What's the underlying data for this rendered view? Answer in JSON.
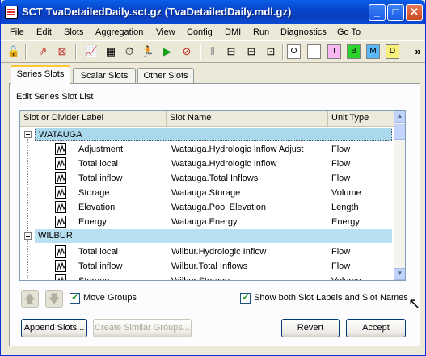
{
  "window": {
    "title": "SCT TvaDetailedDaily.sct.gz (TvaDetailedDaily.mdl.gz)",
    "minimize_label": "_",
    "maximize_label": "□",
    "close_label": "✕"
  },
  "menu": [
    "File",
    "Edit",
    "Slots",
    "Aggregation",
    "View",
    "Config",
    "DMI",
    "Run",
    "Diagnostics",
    "Go To"
  ],
  "toolbar": {
    "color_buttons": [
      {
        "label": "O",
        "color": "#ffffff"
      },
      {
        "label": "I",
        "color": "#ffffff"
      },
      {
        "label": "T",
        "color": "#f7b8f2"
      },
      {
        "label": "B",
        "color": "#2bd42b"
      },
      {
        "label": "M",
        "color": "#5ab8f7"
      },
      {
        "label": "D",
        "color": "#f7f07a"
      }
    ],
    "overflow_label": "»"
  },
  "tabs": [
    {
      "label": "Series Slots",
      "active": true
    },
    {
      "label": "Scalar Slots",
      "active": false
    },
    {
      "label": "Other Slots",
      "active": false
    }
  ],
  "panel": {
    "title": "Edit Series Slot List",
    "columns": [
      "Slot or Divider Label",
      "Slot Name",
      "Unit Type"
    ],
    "groups": [
      {
        "label": "WATAUGA",
        "selected": true,
        "rows": [
          {
            "label": "Adjustment",
            "slot": "Watauga.Hydrologic Inflow Adjust",
            "unit": "Flow"
          },
          {
            "label": "Total local",
            "slot": "Watauga.Hydrologic Inflow",
            "unit": "Flow"
          },
          {
            "label": "Total inflow",
            "slot": "Watauga.Total Inflows",
            "unit": "Flow"
          },
          {
            "label": "Storage",
            "slot": "Watauga.Storage",
            "unit": "Volume"
          },
          {
            "label": "Elevation",
            "slot": "Watauga.Pool Elevation",
            "unit": "Length"
          },
          {
            "label": "Energy",
            "slot": "Watauga.Energy",
            "unit": "Energy"
          }
        ]
      },
      {
        "label": "WILBUR",
        "selected": false,
        "rows": [
          {
            "label": "Total local",
            "slot": "Wilbur.Hydrologic Inflow",
            "unit": "Flow"
          },
          {
            "label": "Total inflow",
            "slot": "Wilbur.Total Inflows",
            "unit": "Flow"
          },
          {
            "label": "Storage",
            "slot": "Wilbur.Storage",
            "unit": "Volume"
          }
        ]
      }
    ],
    "move_groups_label": "Move Groups",
    "move_groups_checked": true,
    "show_both_label": "Show both Slot Labels and Slot Names",
    "show_both_checked": true
  },
  "buttons": {
    "append": "Append Slots...",
    "create_similar": "Create Similar Groups...",
    "revert": "Revert",
    "accept": "Accept"
  }
}
